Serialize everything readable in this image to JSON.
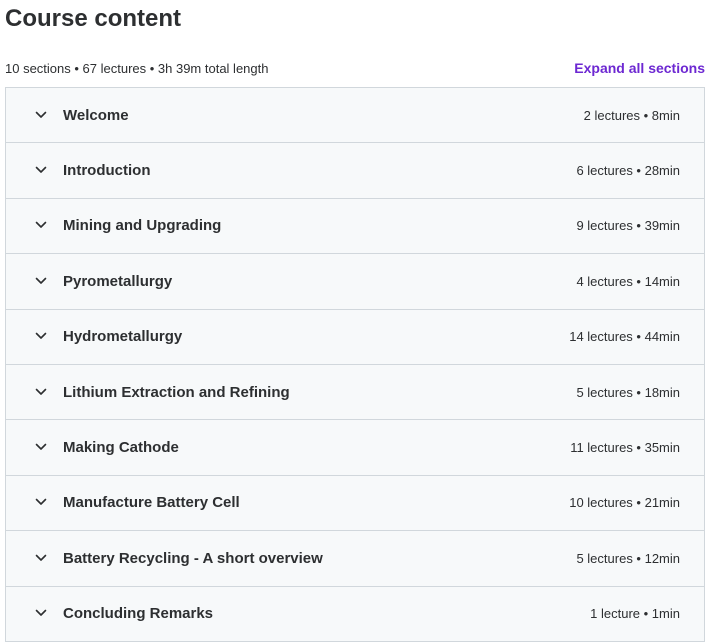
{
  "header": {
    "title": "Course content",
    "summary": "10 sections • 67 lectures • 3h 39m total length",
    "expand_all_label": "Expand all sections"
  },
  "sections": [
    {
      "title": "Welcome",
      "info": "2 lectures • 8min"
    },
    {
      "title": "Introduction",
      "info": "6 lectures • 28min"
    },
    {
      "title": "Mining and Upgrading",
      "info": "9 lectures • 39min"
    },
    {
      "title": "Pyrometallurgy",
      "info": "4 lectures • 14min"
    },
    {
      "title": "Hydrometallurgy",
      "info": "14 lectures • 44min"
    },
    {
      "title": "Lithium Extraction and Refining",
      "info": "5 lectures • 18min"
    },
    {
      "title": "Making Cathode",
      "info": "11 lectures • 35min"
    },
    {
      "title": "Manufacture Battery Cell",
      "info": "10 lectures • 21min"
    },
    {
      "title": "Battery Recycling - A short overview",
      "info": "5 lectures • 12min"
    },
    {
      "title": "Concluding Remarks",
      "info": "1 lecture • 1min"
    }
  ],
  "icons": {
    "section_toggle": "chevron-down-icon"
  },
  "colors": {
    "accent": "#6d28d2",
    "text": "#2d2f31",
    "section_bg": "#f7f9fa",
    "border": "#d1d7dc"
  }
}
